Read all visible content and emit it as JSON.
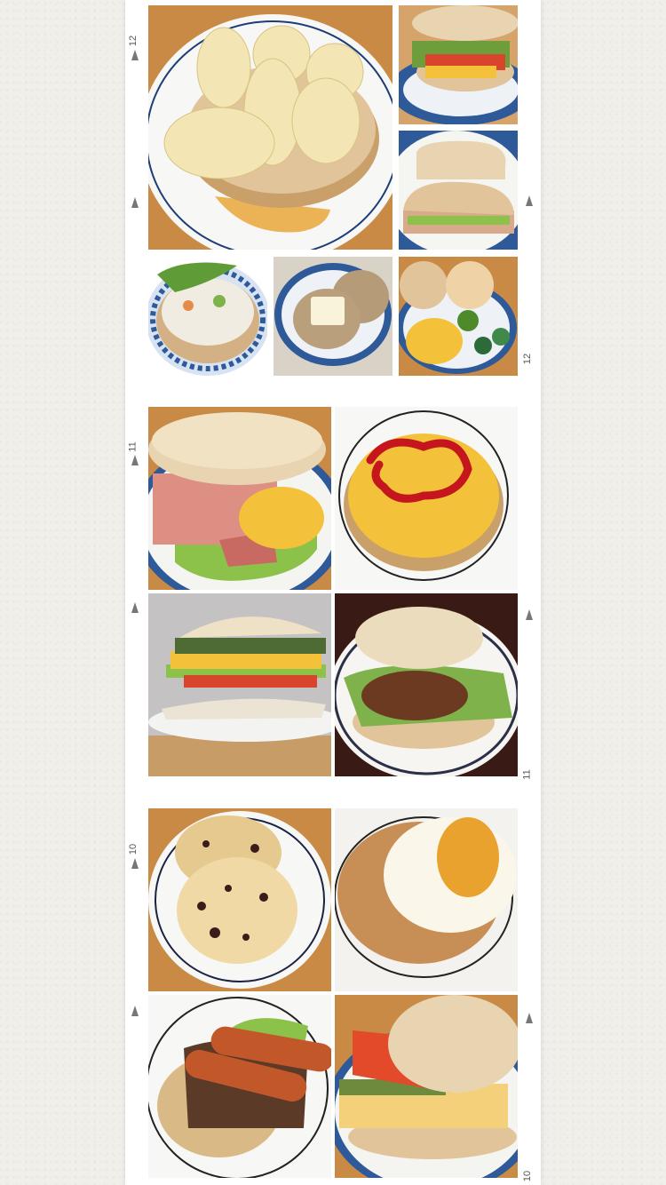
{
  "frame_numbers": [
    "12",
    "12",
    "11",
    "11",
    "10",
    "10"
  ],
  "photos": [
    {
      "id": "banana-muffin",
      "subject": "English muffin topped with banana slices and syrup"
    },
    {
      "id": "ham-egg-sandwich-top",
      "subject": "English muffin sandwich with ham, egg, tomato and lettuce"
    },
    {
      "id": "ham-egg-sandwich-open",
      "subject": "Open English muffin sandwich with ham and egg"
    },
    {
      "id": "potato-salad-muffin",
      "subject": "English muffin with potato salad"
    },
    {
      "id": "butter-muffin",
      "subject": "Toasted English muffin with butter"
    },
    {
      "id": "breakfast-plate",
      "subject": "Breakfast plate with muffins, scrambled eggs, broccoli and cucumber"
    },
    {
      "id": "bacon-egg-muffin",
      "subject": "Bacon, egg and lettuce English muffin"
    },
    {
      "id": "ketchup-egg-muffin",
      "subject": "Scrambled egg with ketchup on English muffin"
    },
    {
      "id": "egg-tomato-muffin-side",
      "subject": "Egg, tomato and lettuce muffin sandwich side view"
    },
    {
      "id": "hamburger-muffin",
      "subject": "Hamburg steak and lettuce English muffin"
    },
    {
      "id": "raisin-cheese-muffin",
      "subject": "Raisin English muffins with cheese"
    },
    {
      "id": "cheese-jam-muffin",
      "subject": "English muffin with melted cheese and marmalade"
    },
    {
      "id": "sausage-muffin",
      "subject": "Sausages and lettuce on English muffin"
    },
    {
      "id": "tomato-egg-salad-muffin",
      "subject": "Tomato and egg salad English muffin sandwich"
    }
  ],
  "colors": {
    "background": "#f1efea",
    "strip": "#ffffff",
    "muffin": "#e2c49a",
    "muffin_crust": "#c9a06a",
    "plate_blue": "#2f5a9a",
    "egg": "#f3c23a",
    "tomato": "#d9442c",
    "lettuce": "#8cc24a",
    "wood": "#c98a45"
  }
}
